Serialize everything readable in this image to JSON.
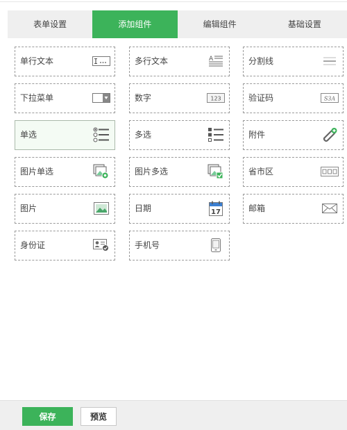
{
  "tabs": [
    {
      "label": "表单设置",
      "active": false
    },
    {
      "label": "添加组件",
      "active": true
    },
    {
      "label": "编辑组件",
      "active": false
    },
    {
      "label": "基础设置",
      "active": false
    }
  ],
  "components": [
    {
      "label": "单行文本",
      "icon": "single-line-text-icon"
    },
    {
      "label": "多行文本",
      "icon": "multi-line-text-icon"
    },
    {
      "label": "分割线",
      "icon": "divider-icon"
    },
    {
      "label": "下拉菜单",
      "icon": "dropdown-icon"
    },
    {
      "label": "数字",
      "icon": "number-icon",
      "icon_text": "123"
    },
    {
      "label": "验证码",
      "icon": "captcha-icon",
      "icon_text": "S3A"
    },
    {
      "label": "单选",
      "icon": "radio-list-icon",
      "selected": true
    },
    {
      "label": "多选",
      "icon": "checkbox-list-icon"
    },
    {
      "label": "附件",
      "icon": "paperclip-icon"
    },
    {
      "label": "图片单选",
      "icon": "image-radio-icon"
    },
    {
      "label": "图片多选",
      "icon": "image-checkbox-icon"
    },
    {
      "label": "省市区",
      "icon": "region-select-icon"
    },
    {
      "label": "图片",
      "icon": "image-icon"
    },
    {
      "label": "日期",
      "icon": "calendar-icon",
      "icon_text": "17"
    },
    {
      "label": "邮箱",
      "icon": "envelope-icon"
    },
    {
      "label": "身份证",
      "icon": "id-card-icon"
    },
    {
      "label": "手机号",
      "icon": "mobile-phone-icon"
    }
  ],
  "footer": {
    "save_label": "保存",
    "preview_label": "预览"
  },
  "colors": {
    "accent": "#3cb35a",
    "tab_bar": "#efefef",
    "card_border": "#9a9a9a"
  }
}
